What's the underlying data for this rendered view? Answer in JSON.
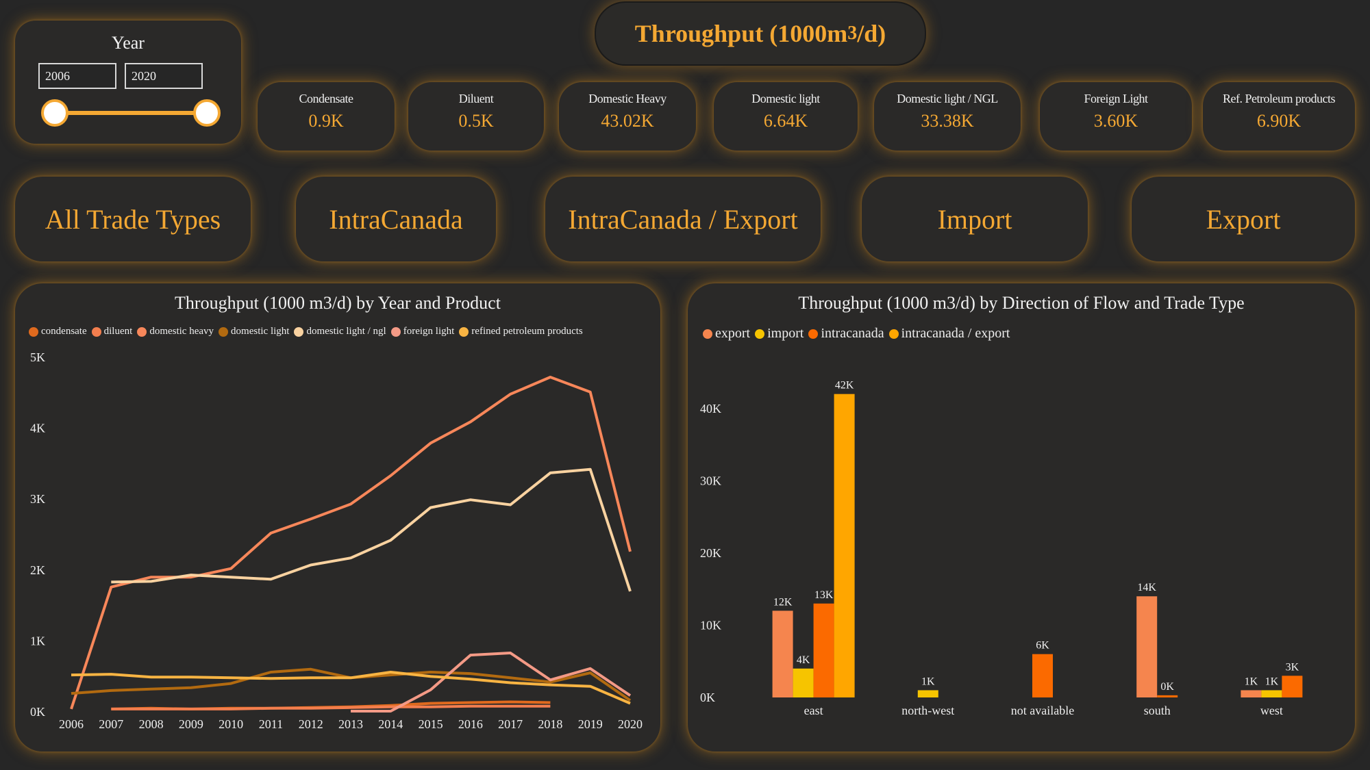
{
  "header": {
    "title_main": "Throughput (1000m",
    "title_sup": "3",
    "title_end": "/d)"
  },
  "year_filter": {
    "label": "Year",
    "start": "2006",
    "end": "2020"
  },
  "kpis": [
    {
      "label": "Condensate",
      "value": "0.9K"
    },
    {
      "label": "Diluent",
      "value": "0.5K"
    },
    {
      "label": "Domestic Heavy",
      "value": "43.02K"
    },
    {
      "label": "Domestic light",
      "value": "6.64K"
    },
    {
      "label": "Domestic light / NGL",
      "value": "33.38K"
    },
    {
      "label": "Foreign Light",
      "value": "3.60K"
    },
    {
      "label": "Ref. Petroleum products",
      "value": "6.90K"
    }
  ],
  "trade_buttons": [
    "All Trade Types",
    "IntraCanada",
    "IntraCanada / Export",
    "Import",
    "Export"
  ],
  "colors": {
    "accent": "#f4a833",
    "background": "#262626",
    "card": "#2a2928"
  },
  "chart_data": [
    {
      "type": "line",
      "title": "Throughput (1000 m3/d) by Year and Product",
      "legend_position": "top",
      "x": [
        2006,
        2007,
        2008,
        2009,
        2010,
        2011,
        2012,
        2013,
        2014,
        2015,
        2016,
        2017,
        2018,
        2019,
        2020
      ],
      "yticks": [
        "0K",
        "1K",
        "2K",
        "3K",
        "4K",
        "5K"
      ],
      "ylim": [
        0,
        5000
      ],
      "series": [
        {
          "name": "condensate",
          "color": "#e06a1e",
          "values": [
            null,
            40,
            50,
            40,
            50,
            50,
            60,
            70,
            90,
            120,
            130,
            140,
            130,
            null,
            null
          ]
        },
        {
          "name": "diluent",
          "color": "#f37e4e",
          "values": [
            null,
            40,
            40,
            40,
            40,
            50,
            50,
            60,
            70,
            70,
            80,
            80,
            80,
            null,
            null
          ]
        },
        {
          "name": "domestic heavy",
          "color": "#f7875a",
          "values": [
            40,
            1760,
            1900,
            1900,
            2020,
            2520,
            2720,
            2930,
            3330,
            3790,
            4090,
            4480,
            4720,
            4510,
            2260
          ]
        },
        {
          "name": "domestic light",
          "color": "#b26a10",
          "values": [
            260,
            300,
            320,
            340,
            400,
            560,
            600,
            480,
            520,
            560,
            540,
            480,
            420,
            550,
            160
          ]
        },
        {
          "name": "domestic light / ngl",
          "color": "#f9d2a0",
          "values": [
            null,
            1830,
            1840,
            1930,
            1900,
            1870,
            2070,
            2170,
            2420,
            2880,
            2990,
            2920,
            3370,
            3420,
            1700
          ]
        },
        {
          "name": "foreign light",
          "color": "#f49a86",
          "values": [
            null,
            null,
            null,
            null,
            null,
            null,
            null,
            10,
            10,
            310,
            800,
            830,
            450,
            610,
            230
          ]
        },
        {
          "name": "refined petroleum products",
          "color": "#f8b443",
          "values": [
            520,
            530,
            490,
            490,
            480,
            470,
            480,
            480,
            560,
            500,
            460,
            410,
            380,
            360,
            120
          ]
        }
      ]
    },
    {
      "type": "bar",
      "title": "Throughput (1000 m3/d) by Direction of Flow and Trade Type",
      "legend_position": "top",
      "categories": [
        "east",
        "north-west",
        "not available",
        "south",
        "west"
      ],
      "yticks": [
        "0K",
        "10K",
        "20K",
        "30K",
        "40K"
      ],
      "ylim": [
        0,
        45000
      ],
      "series": [
        {
          "name": "export",
          "color": "#f5854e",
          "values": [
            12000,
            null,
            null,
            14000,
            1000
          ],
          "labels": [
            "12K",
            "",
            "",
            "14K",
            "1K"
          ]
        },
        {
          "name": "import",
          "color": "#f6c400",
          "values": [
            4000,
            1000,
            null,
            null,
            1000
          ],
          "labels": [
            "4K",
            "1K",
            "",
            "",
            "1K"
          ]
        },
        {
          "name": "intracanada",
          "color": "#fb6a00",
          "values": [
            13000,
            null,
            6000,
            300,
            3000
          ],
          "labels": [
            "13K",
            "",
            "6K",
            "0K",
            "3K"
          ]
        },
        {
          "name": "intracanada / export",
          "color": "#ffa600",
          "values": [
            42000,
            null,
            null,
            null,
            null
          ],
          "labels": [
            "42K",
            "",
            "",
            "",
            ""
          ]
        }
      ]
    }
  ]
}
